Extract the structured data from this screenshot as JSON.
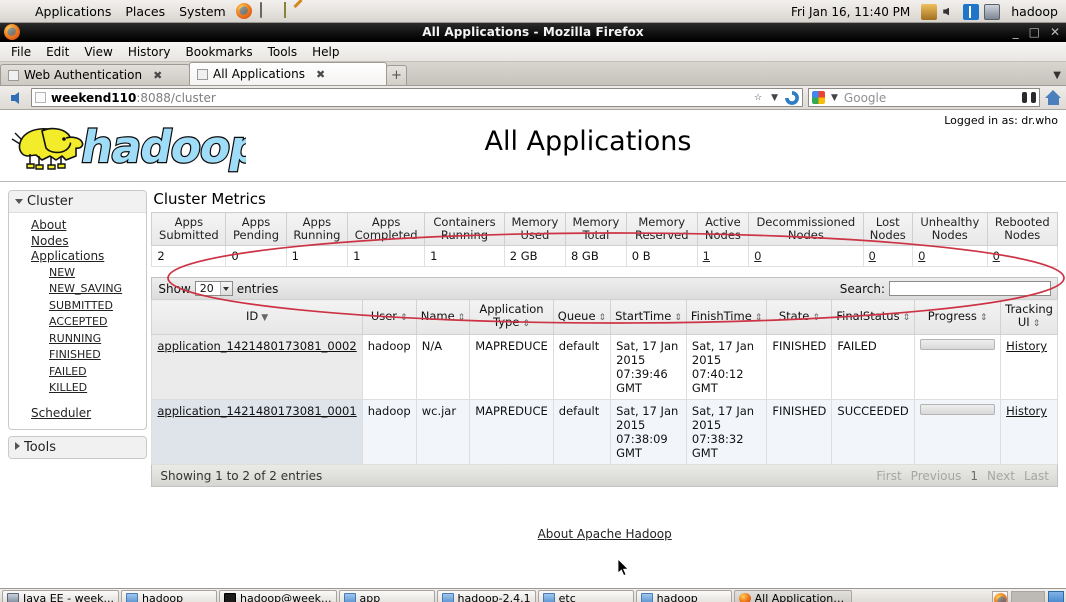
{
  "desktop": {
    "panel": {
      "menus": [
        "Applications",
        "Places",
        "System"
      ],
      "launchers": [
        "firefox-icon",
        "files-icon",
        "text-editor-icon"
      ],
      "clock": "Fri Jan 16, 11:40 PM",
      "tray": [
        "network-icon",
        "volume-icon",
        "bluetooth-icon",
        "display-icon"
      ],
      "user": "hadoop"
    },
    "taskbar": {
      "items": [
        {
          "label": "Java EE - week...",
          "icon": "java-icon"
        },
        {
          "label": "hadoop",
          "icon": "folder-icon"
        },
        {
          "label": "hadoop@week...",
          "icon": "terminal-icon"
        },
        {
          "label": "app",
          "icon": "folder-icon"
        },
        {
          "label": "hadoop-2.4.1",
          "icon": "folder-icon"
        },
        {
          "label": "etc",
          "icon": "folder-icon"
        },
        {
          "label": "hadoop",
          "icon": "folder-icon"
        },
        {
          "label": "All Applications...",
          "icon": "firefox-icon"
        }
      ]
    }
  },
  "browser": {
    "window_title": "All Applications - Mozilla Firefox",
    "window_buttons": [
      "minimize",
      "maximize",
      "close"
    ],
    "menus": [
      "File",
      "Edit",
      "View",
      "History",
      "Bookmarks",
      "Tools",
      "Help"
    ],
    "tabs": [
      {
        "label": "Web Authentication",
        "active": false
      },
      {
        "label": "All Applications",
        "active": true
      }
    ],
    "new_tab_label": "+",
    "url": {
      "host": "weekend110",
      "rest": ":8088/cluster"
    },
    "search": {
      "engine": "google-icon",
      "placeholder": "Google"
    }
  },
  "page": {
    "logged_in_as": "Logged in as: dr.who",
    "title": "All Applications",
    "logo_alt": "hadoop-logo",
    "footer_link": "About Apache Hadoop"
  },
  "sidebar": {
    "cluster": {
      "header": "Cluster",
      "items": [
        "About",
        "Nodes",
        "Applications"
      ],
      "application_states": [
        "NEW",
        "NEW_SAVING",
        "SUBMITTED",
        "ACCEPTED",
        "RUNNING",
        "FINISHED",
        "FAILED",
        "KILLED"
      ],
      "scheduler": "Scheduler"
    },
    "tools": {
      "header": "Tools"
    }
  },
  "cluster_metrics": {
    "title": "Cluster Metrics",
    "headers": [
      "Apps Submitted",
      "Apps Pending",
      "Apps Running",
      "Apps Completed",
      "Containers Running",
      "Memory Used",
      "Memory Total",
      "Memory Reserved",
      "Active Nodes",
      "Decommissioned Nodes",
      "Lost Nodes",
      "Unhealthy Nodes",
      "Rebooted Nodes"
    ],
    "values": [
      "2",
      "0",
      "1",
      "1",
      "1",
      "2 GB",
      "8 GB",
      "0 B",
      "1",
      "0",
      "0",
      "0",
      "0"
    ],
    "linked": [
      false,
      false,
      false,
      false,
      false,
      false,
      false,
      false,
      true,
      true,
      true,
      true,
      true
    ]
  },
  "datatable": {
    "show_label": "Show",
    "page_length": "20",
    "entries_label": "entries",
    "search_label": "Search:",
    "search_value": "",
    "headers": [
      "ID",
      "User",
      "Name",
      "Application Type",
      "Queue",
      "StartTime",
      "FinishTime",
      "State",
      "FinalStatus",
      "Progress",
      "Tracking UI"
    ],
    "rows": [
      {
        "id": "application_1421480173081_0002",
        "user": "hadoop",
        "name": "N/A",
        "type": "MAPREDUCE",
        "queue": "default",
        "start_time": "Sat, 17 Jan 2015 07:39:46 GMT",
        "finish_time": "Sat, 17 Jan 2015 07:40:12 GMT",
        "state": "FINISHED",
        "final_status": "FAILED",
        "progress": "",
        "tracking_ui": "History"
      },
      {
        "id": "application_1421480173081_0001",
        "user": "hadoop",
        "name": "wc.jar",
        "type": "MAPREDUCE",
        "queue": "default",
        "start_time": "Sat, 17 Jan 2015 07:38:09 GMT",
        "finish_time": "Sat, 17 Jan 2015 07:38:32 GMT",
        "state": "FINISHED",
        "final_status": "SUCCEEDED",
        "progress": "",
        "tracking_ui": "History"
      }
    ],
    "info": "Showing 1 to 2 of 2 entries",
    "paginate": {
      "first": "First",
      "previous": "Previous",
      "page": "1",
      "next": "Next",
      "last": "Last"
    }
  },
  "annotation": {
    "shape": "ellipse",
    "color": "#cc3344"
  }
}
